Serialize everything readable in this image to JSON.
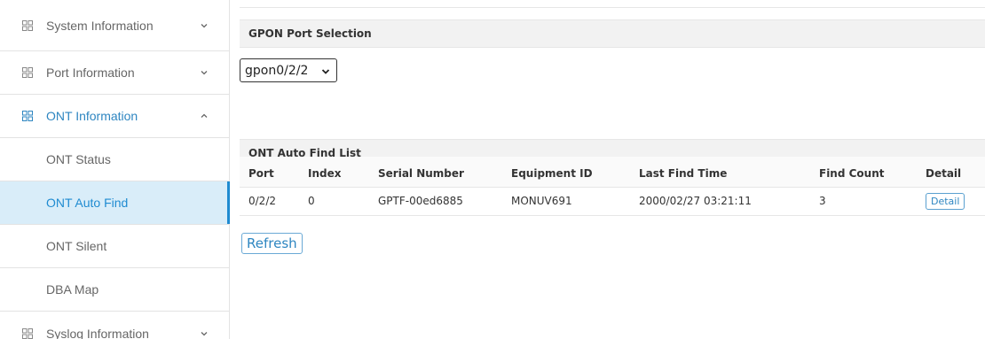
{
  "sidebar": {
    "items": [
      {
        "label": "System Information"
      },
      {
        "label": "Port Information"
      },
      {
        "label": "ONT Information"
      },
      {
        "label": "ONT Status"
      },
      {
        "label": "ONT Auto Find"
      },
      {
        "label": "ONT Silent"
      },
      {
        "label": "DBA Map"
      },
      {
        "label": "Syslog Information"
      }
    ]
  },
  "main": {
    "port_section_title": "GPON Port Selection",
    "port_select_value": "gpon0/2/2",
    "list_title": "ONT Auto Find List",
    "table": {
      "headers": [
        "Port",
        "Index",
        "Serial Number",
        "Equipment ID",
        "Last Find Time",
        "Find Count",
        "Detail"
      ],
      "rows": [
        [
          "0/2/2",
          "0",
          "GPTF-00ed6885",
          "MONUV691",
          "2000/02/27 03:21:11",
          "3",
          "Detail"
        ]
      ]
    },
    "refresh_label": "Refresh"
  },
  "colors": {
    "accent": "#1f8bd1",
    "active_bg": "#d9edf9",
    "header_bg": "#f2f2f2"
  },
  "icons": {
    "group": "grid-icon",
    "collapsed": "chevron-down-icon",
    "expanded": "chevron-up-icon"
  }
}
